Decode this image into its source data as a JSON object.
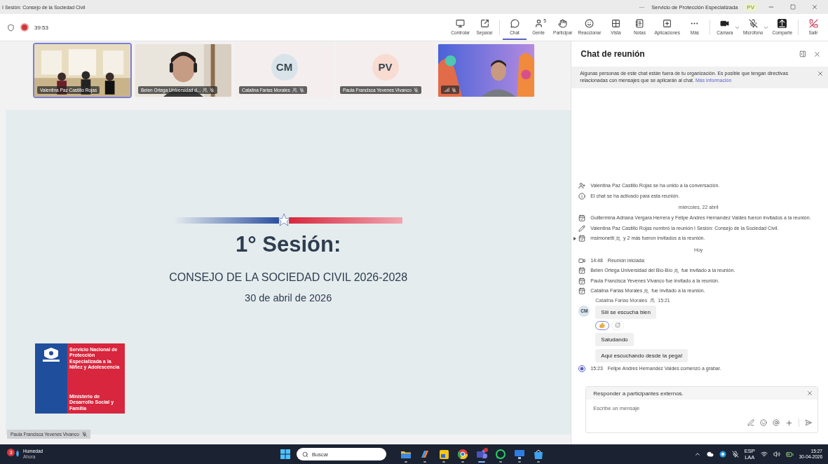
{
  "window": {
    "title": "I Sesión: Consejo de la Sociedad Civil",
    "more": "···",
    "org": "Servicio de Protección Especializada",
    "user_initials": "PV"
  },
  "meeting_bar": {
    "recording": true,
    "timer": "39:53",
    "tools": [
      {
        "kind": "control",
        "label": "Controlar",
        "selected": false
      },
      {
        "kind": "popout",
        "label": "Separar",
        "selected": false
      },
      {
        "kind": "chat",
        "label": "Chat",
        "selected": true
      },
      {
        "kind": "people",
        "label": "Gente",
        "badge": "5",
        "selected": false
      },
      {
        "kind": "hand",
        "label": "Participar",
        "selected": false
      },
      {
        "kind": "react",
        "label": "Reaccionar",
        "selected": false
      },
      {
        "kind": "view",
        "label": "Vista",
        "selected": false
      },
      {
        "kind": "notes",
        "label": "Notas",
        "selected": false
      },
      {
        "kind": "apps",
        "label": "Aplicaciones",
        "selected": false
      },
      {
        "kind": "more",
        "label": "Más",
        "selected": false
      },
      {
        "kind": "camera",
        "label": "Cámara",
        "selected": false
      },
      {
        "kind": "mic",
        "label": "Micrófono",
        "muted": true,
        "selected": false
      },
      {
        "kind": "share",
        "label": "Comparte",
        "selected": false
      },
      {
        "kind": "leave",
        "label": "Salir",
        "selected": false
      }
    ]
  },
  "participants": [
    {
      "kind": "video",
      "name": "Valentina Paz Castillo Rojas",
      "speaking": true,
      "muted": false,
      "external": false
    },
    {
      "kind": "video",
      "name": "Belen Ortega Universidad d...",
      "speaking": false,
      "muted": true,
      "external": true
    },
    {
      "kind": "avatar",
      "initials": "CM",
      "color": "#d9e4ea",
      "name": "Catalina Farias Morales",
      "speaking": false,
      "muted": true,
      "external": true
    },
    {
      "kind": "avatar",
      "initials": "PV",
      "color": "#f8dcd2",
      "name": "Paula Francisca Yevenes Vivanco",
      "speaking": false,
      "muted": true,
      "external": false
    },
    {
      "kind": "video",
      "speaking": false,
      "muted": true,
      "external": false
    }
  ],
  "slide": {
    "title": "1° Sesión:",
    "subtitle": "CONSEJO DE LA SOCIEDAD CIVIL 2026-2028",
    "date": "30 de abril de 2026",
    "logo_top": "Servicio Nacional de Protección Especializada a la Niñez y Adolescencia",
    "logo_bottom": "Ministerio de Desarrollo Social y Familia"
  },
  "speaker_tag": {
    "name": "Paula Francisca Yevenes Vivanco",
    "muted": true
  },
  "chat": {
    "title": "Chat de reunión",
    "notice": {
      "text": "Algunas personas de este chat están fuera de tu organización. Es posible que tengan directivas relacionadas con mensajes que se aplicarán al chat.",
      "link": "Más información"
    },
    "events": [
      {
        "kind": "joined",
        "text": "Valentina Paz Castillo Rojas se ha unido a la conversación."
      },
      {
        "kind": "activated",
        "text": "El chat se ha activado para esta reunión."
      },
      {
        "kind": "date",
        "text": "miércoles, 22 abril"
      },
      {
        "kind": "invited",
        "text": "Guillermina Adriana Vergara Herrera y Felipe Andres Hernandez Valdes fueron invitados a la reunión."
      },
      {
        "kind": "renamed",
        "text": "Valentina Paz Castillo Rojas nombró la reunión I Sesión: Consejo de la Sociedad Civil."
      },
      {
        "kind": "invited",
        "collapsed": true,
        "name": "msimonetti",
        "external": true,
        "text": "y 2 más fueron invitados a la reunión."
      },
      {
        "kind": "date",
        "text": "Hoy"
      },
      {
        "kind": "started",
        "time": "14:48",
        "text": "Reunión iniciada:"
      },
      {
        "kind": "invited",
        "name": "Belen Ortega Universidad del Bío-Bío",
        "external": true,
        "text": "fue invitado a la reunión."
      },
      {
        "kind": "invited",
        "text": "Paula Francisca Yevenes Vivanco fue invitado a la reunión."
      },
      {
        "kind": "invited",
        "name": "Catalina Farias Morales",
        "external": true,
        "text": "fue invitado a la reunión."
      },
      {
        "kind": "sender",
        "name": "Catalina Farias Morales",
        "external": true,
        "time": "15:21"
      },
      {
        "kind": "message",
        "initials": "CM",
        "text": "Siii se escucha bien",
        "reacted": true
      },
      {
        "kind": "message",
        "text": "Saludando"
      },
      {
        "kind": "message",
        "text": "Aqui escuchando desde la pega!"
      },
      {
        "kind": "recording",
        "time": "15:23",
        "text": "Felipe Andres Hernandez Valdes comenzó a grabar."
      }
    ],
    "compose": {
      "banner": "Responder a participantes externos.",
      "placeholder": "Escribe un mensaje"
    }
  },
  "taskbar": {
    "weather": {
      "badge": "3",
      "title": "Humedad",
      "subtitle": "Ahora"
    },
    "search_placeholder": "Buscar",
    "apps": [
      {
        "kind": "folder",
        "active": false
      },
      {
        "kind": "copilot",
        "active": false
      },
      {
        "kind": "notes",
        "active": false
      },
      {
        "kind": "browser",
        "active": false
      },
      {
        "kind": "teams",
        "active": true,
        "notification": true
      },
      {
        "kind": "whatsapp",
        "active": false
      },
      {
        "kind": "remote",
        "active": false
      },
      {
        "kind": "store",
        "active": false
      }
    ],
    "language": "ESP",
    "layout": "LAA",
    "time": "15:27",
    "date": "30-04-2026"
  }
}
